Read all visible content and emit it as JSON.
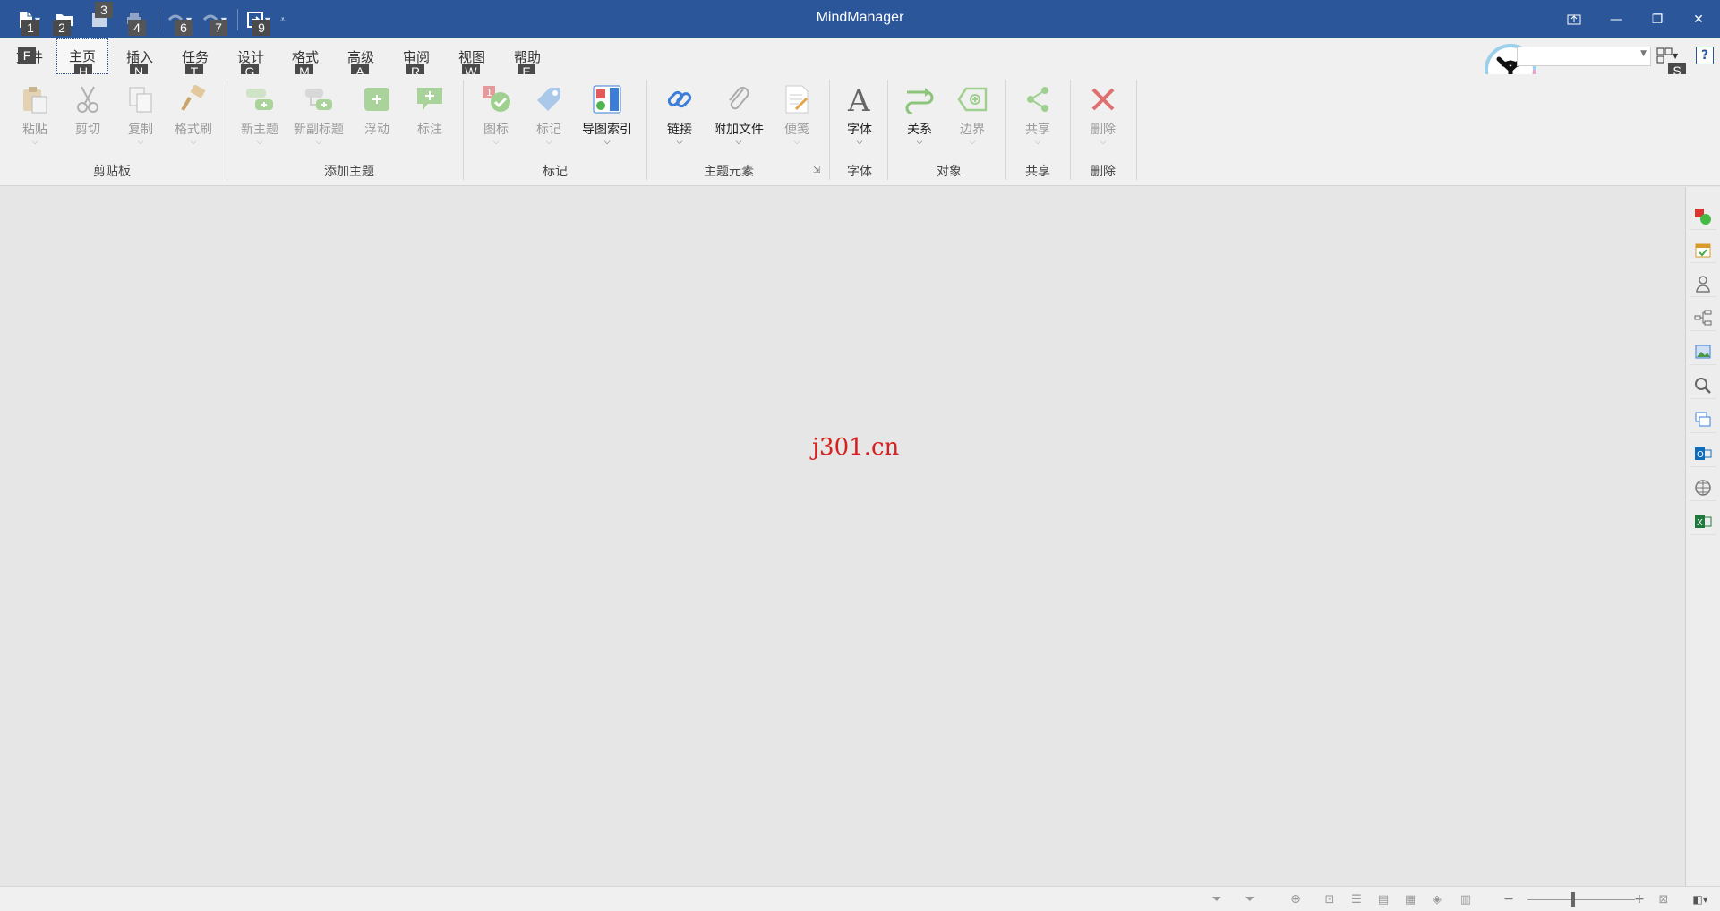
{
  "window": {
    "title": "MindManager",
    "controls": [
      "ribbon-display-icon",
      "minimize-icon",
      "restore-icon",
      "close-icon"
    ]
  },
  "qat": {
    "items": [
      {
        "name": "new-document",
        "keytip": "1"
      },
      {
        "name": "open",
        "keytip": "2"
      },
      {
        "name": "save",
        "keytip": "3"
      },
      {
        "name": "print",
        "keytip": "4"
      },
      {
        "name": "undo",
        "keytip": "6"
      },
      {
        "name": "redo",
        "keytip": "7"
      },
      {
        "name": "send",
        "keytip": "9"
      }
    ]
  },
  "tabs": [
    {
      "label": "文件",
      "keytip": "F"
    },
    {
      "label": "主页",
      "keytip": "H",
      "active": true
    },
    {
      "label": "插入",
      "keytip": "N"
    },
    {
      "label": "任务",
      "keytip": "T"
    },
    {
      "label": "设计",
      "keytip": "G"
    },
    {
      "label": "格式",
      "keytip": "M"
    },
    {
      "label": "高级",
      "keytip": "A"
    },
    {
      "label": "审阅",
      "keytip": "R"
    },
    {
      "label": "视图",
      "keytip": "W"
    },
    {
      "label": "帮助",
      "keytip": "E"
    }
  ],
  "search_keytip": "S",
  "ribbon": {
    "clipboard": {
      "group": "剪贴板",
      "paste": "粘贴",
      "cut": "剪切",
      "copy": "复制",
      "format_painter": "格式刷"
    },
    "add_topic": {
      "group": "添加主题",
      "new_topic": "新主题",
      "new_subtopic": "新副标题",
      "floating": "浮动",
      "callout": "标注"
    },
    "markers": {
      "group": "标记",
      "icons": "图标",
      "tags": "标记",
      "map_index": "导图索引"
    },
    "topic_elements": {
      "group": "主题元素",
      "link": "链接",
      "attach": "附加文件",
      "notes": "便笺"
    },
    "font": {
      "group": "字体",
      "font": "字体"
    },
    "objects": {
      "group": "对象",
      "relationship": "关系",
      "boundary": "边界"
    },
    "share": {
      "group": "共享",
      "share": "共享"
    },
    "delete": {
      "group": "删除",
      "delete": "删除"
    }
  },
  "canvas": {
    "watermark": "j301.cn"
  },
  "colors": {
    "titlebar": "#2b579a",
    "canvas": "#e6e6e6",
    "watermark": "#d62020",
    "ribbon": "#f0f0f0"
  }
}
